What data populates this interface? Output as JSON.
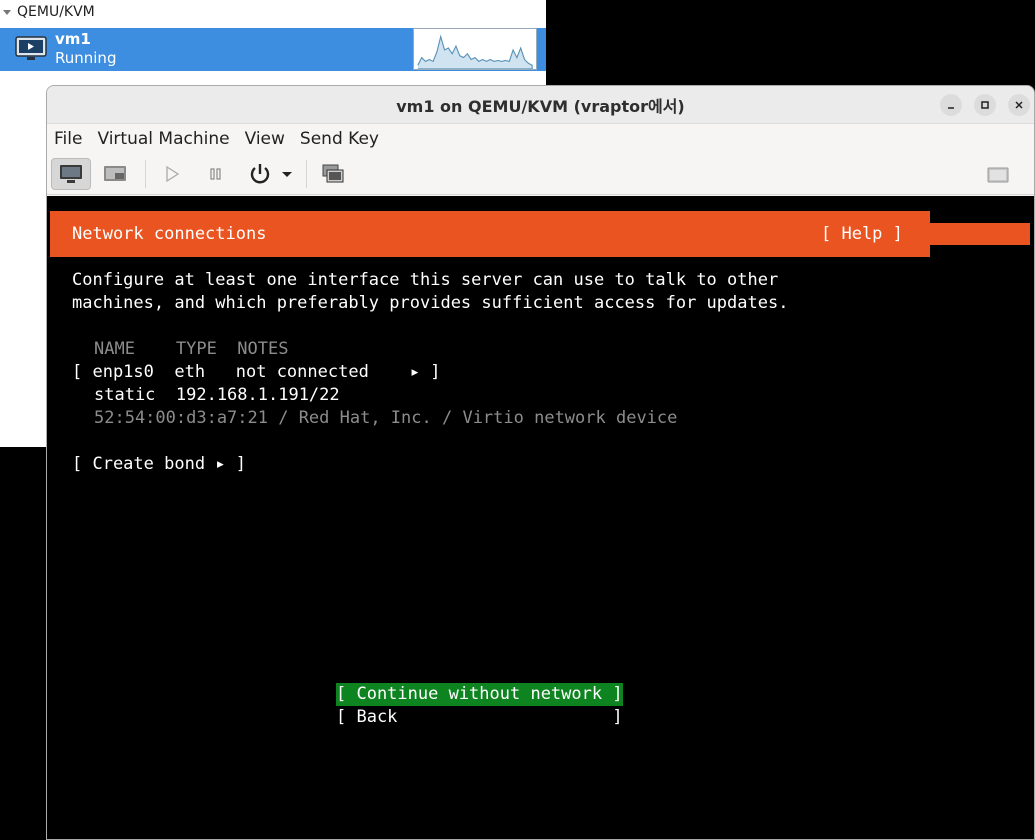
{
  "manager": {
    "group": "QEMU/KVM",
    "vm_name": "vm1",
    "vm_status": "Running"
  },
  "window": {
    "title": "vm1 on QEMU/KVM (vraptor에서)"
  },
  "menu": {
    "file": "File",
    "virtual_machine": "Virtual Machine",
    "view": "View",
    "send_key": "Send Key"
  },
  "installer": {
    "header_title": "Network connections",
    "help": "[ Help ]",
    "intro_line1": "Configure at least one interface this server can use to talk to other",
    "intro_line2": "machines, and which preferably provides sufficient access for updates.",
    "columns": "NAME    TYPE  NOTES",
    "iface_row": "[ enp1s0  eth   not connected    ▸ ]",
    "iface_static": "static  192.168.1.191/22",
    "iface_desc": "52:54:00:d3:a7:21 / Red Hat, Inc. / Virtio network device",
    "create_bond": "[ Create bond ▸ ]",
    "continue_button": "[ Continue without network ]",
    "back_button": "[ Back                     ]"
  },
  "colors": {
    "ubuntu_orange": "#e95420",
    "selected_green": "#0e8420",
    "selection_blue": "#3d8ee0"
  }
}
